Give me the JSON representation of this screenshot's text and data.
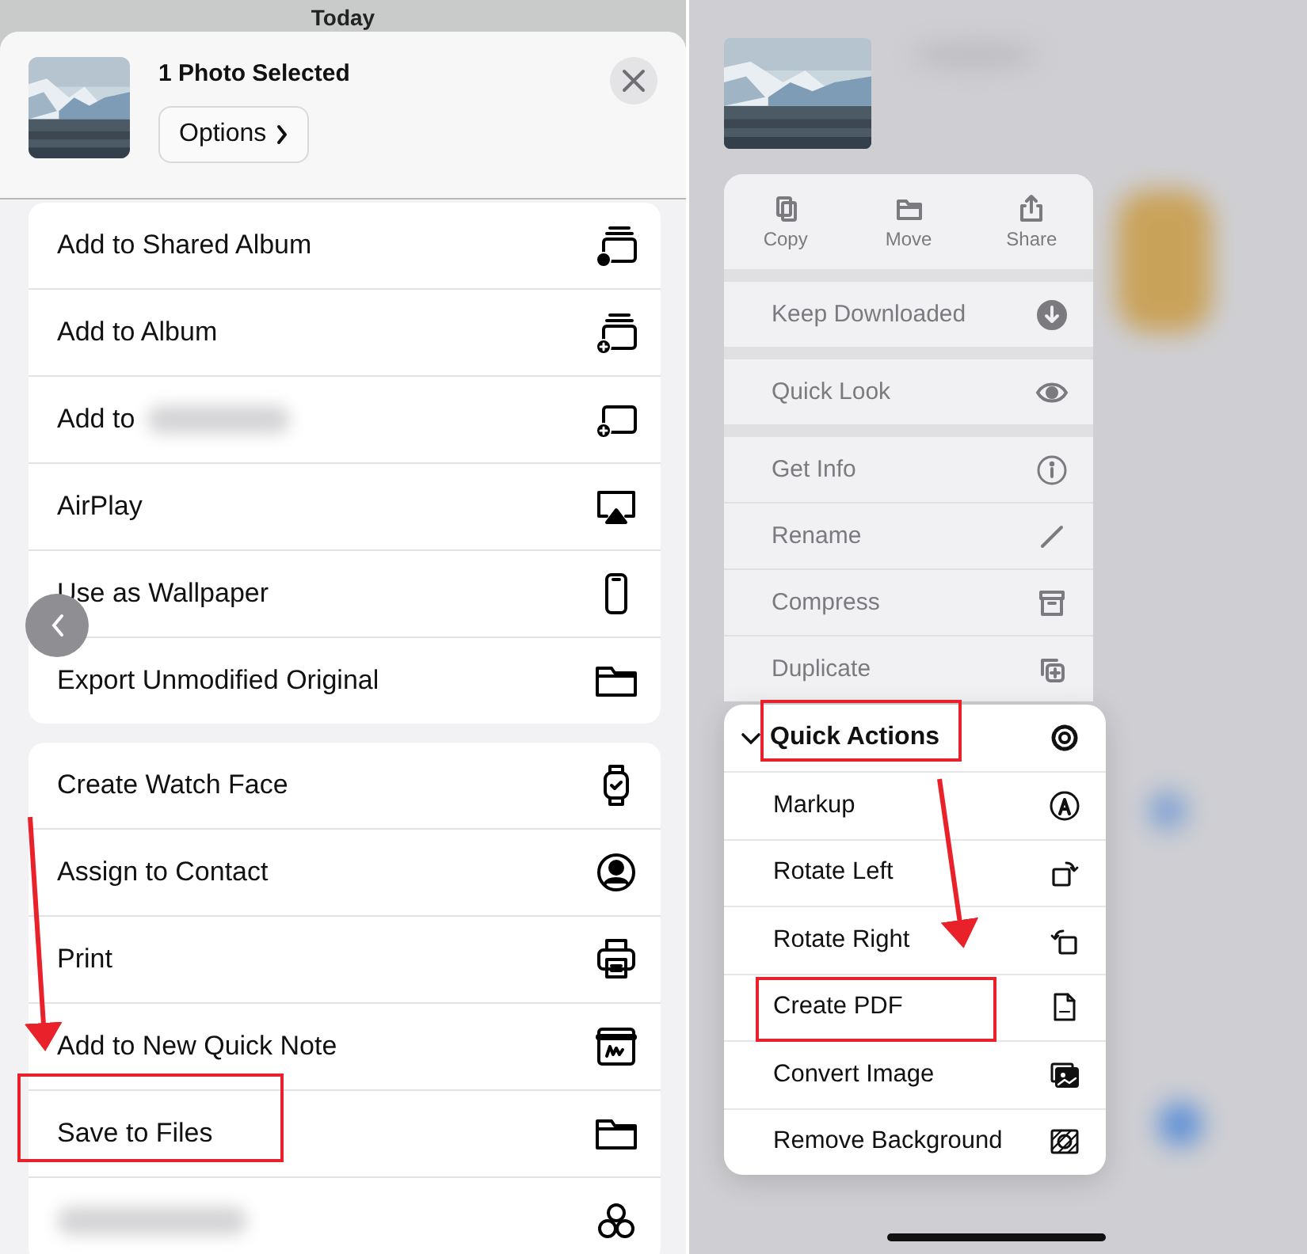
{
  "background_header": {
    "title": "Today"
  },
  "share_sheet": {
    "title": "1 Photo Selected",
    "options_button": "Options",
    "groups": [
      [
        {
          "label": "Add to Shared Album",
          "redacted": false
        },
        {
          "label": "Add to Album",
          "redacted": false
        },
        {
          "label": "Add to",
          "redacted": true
        },
        {
          "label": "AirPlay",
          "redacted": false
        },
        {
          "label": "Use as Wallpaper",
          "redacted": false
        },
        {
          "label": "Export Unmodified Original",
          "redacted": false
        }
      ],
      [
        {
          "label": "Create Watch Face",
          "redacted": false
        },
        {
          "label": "Assign to Contact",
          "redacted": false
        },
        {
          "label": "Print",
          "redacted": false
        },
        {
          "label": "Add to New Quick Note",
          "redacted": false
        },
        {
          "label": "Save to Files",
          "redacted": false
        },
        {
          "redacted": true
        }
      ]
    ]
  },
  "file_menu": {
    "dimmed": true,
    "actions": [
      {
        "label": "Copy"
      },
      {
        "label": "Move"
      },
      {
        "label": "Share"
      }
    ],
    "sections": [
      [
        {
          "label": "Keep Downloaded"
        }
      ],
      [
        {
          "label": "Quick Look"
        }
      ],
      [
        {
          "label": "Get Info"
        },
        {
          "label": "Rename"
        },
        {
          "label": "Compress"
        },
        {
          "label": "Duplicate"
        }
      ]
    ]
  },
  "quick_actions": {
    "title": "Quick Actions",
    "expanded": true,
    "items": [
      {
        "label": "Markup"
      },
      {
        "label": "Rotate Left"
      },
      {
        "label": "Rotate Right"
      },
      {
        "label": "Create PDF"
      },
      {
        "label": "Convert Image"
      },
      {
        "label": "Remove Background"
      }
    ]
  }
}
